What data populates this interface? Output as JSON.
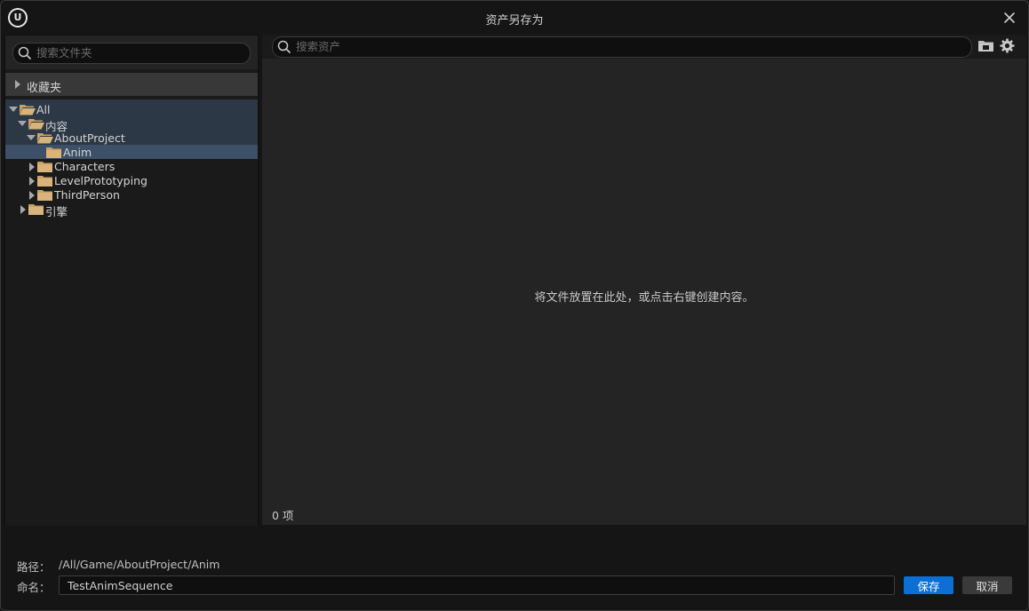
{
  "window": {
    "title": "资产另存为",
    "logo_text": "U"
  },
  "colors": {
    "accent": "#0c6fd6",
    "folder": "#c8a267",
    "selected_row": "#3d5068"
  },
  "left": {
    "search_placeholder": "搜索文件夹",
    "favorites_label": "收藏夹",
    "tree": [
      {
        "label": "All",
        "depth": 0,
        "expanded": true,
        "selected": false
      },
      {
        "label": "内容",
        "depth": 1,
        "expanded": true,
        "selected": false
      },
      {
        "label": "AboutProject",
        "depth": 2,
        "expanded": true,
        "selected": false
      },
      {
        "label": "Anim",
        "depth": 3,
        "expanded": false,
        "selected": true,
        "leaf": true
      },
      {
        "label": "Characters",
        "depth": 2,
        "expanded": false,
        "selected": false
      },
      {
        "label": "LevelPrototyping",
        "depth": 2,
        "expanded": false,
        "selected": false
      },
      {
        "label": "ThirdPerson",
        "depth": 2,
        "expanded": false,
        "selected": false
      },
      {
        "label": "引擎",
        "depth": 1,
        "expanded": false,
        "selected": false
      }
    ]
  },
  "right": {
    "search_placeholder": "搜索资产",
    "empty_message": "将文件放置在此处，或点击右键创建内容。",
    "item_count": "0 项"
  },
  "bottom": {
    "path_label": "路径：",
    "path_value": "/All/Game/AboutProject/Anim",
    "name_label": "命名：",
    "name_value": "TestAnimSequence",
    "save_label": "保存",
    "cancel_label": "取消"
  }
}
